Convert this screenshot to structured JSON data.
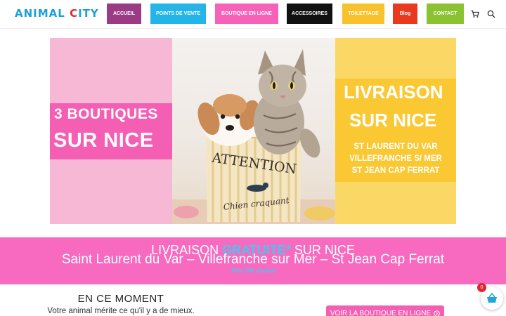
{
  "header": {
    "logo_part1": "ANIMAL ",
    "logo_part2": "C",
    "logo_part3": "ITY",
    "nav": [
      {
        "label": "ACCUEIL",
        "color": "#9b3b86"
      },
      {
        "label": "POINTS DE VENTE",
        "color": "#23b5e8"
      },
      {
        "label": "BOUTIQUE EN LIGNE",
        "color": "#f861b9"
      },
      {
        "label": "ACCESSOIRES",
        "color": "#111111"
      },
      {
        "label": "TOILETTAGE",
        "color": "#f9c12b"
      },
      {
        "label": "Blog",
        "color": "#e93a1f"
      },
      {
        "label": "CONTACT",
        "color": "#8bc232"
      }
    ]
  },
  "hero": {
    "left_line1": "3 BOUTIQUES",
    "left_line2": "SUR NICE",
    "right_line1": "LIVRAISON",
    "right_line2": "SUR NICE",
    "right_towns": [
      "ST LAURENT DU VAR",
      "VILLEFRANCHE S/ MER",
      "ST JEAN CAP FERRAT"
    ],
    "can_text1": "ATTENTION",
    "can_text2": "Chien craquant"
  },
  "promo": {
    "line1_a": "LIVRAISON ",
    "line1_b": "GRATUITE*",
    "line1_c": " SUR NICE",
    "line2": "Saint Laurent du Var – Villefranche sur Mer – St Jean Cap Ferrat",
    "line3": "*Dès 35€ d'achat"
  },
  "moment": {
    "title": "EN CE MOMENT",
    "subtitle": "Votre animal mérite ce qu'il y a de mieux.",
    "button": "VOIR LA BOUTIQUE EN LIGNE"
  },
  "cart": {
    "count": "0"
  }
}
